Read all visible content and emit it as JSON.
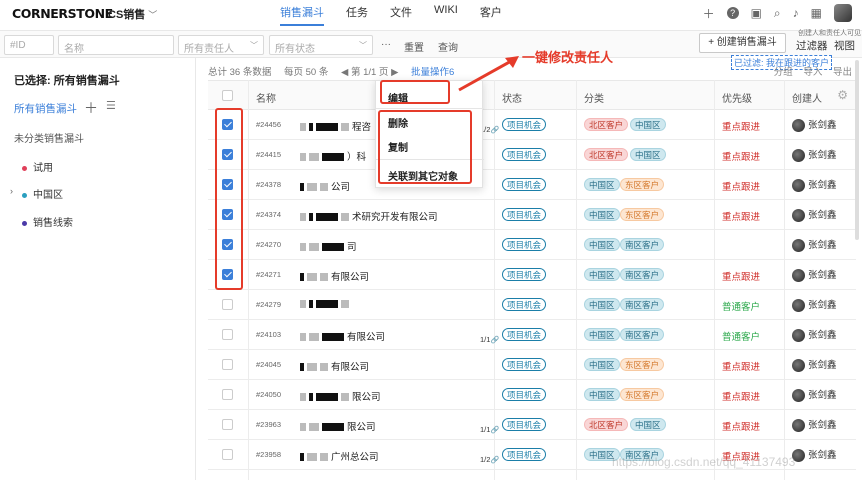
{
  "topbar": {
    "logo": "CORNERSTONE",
    "app": "CS销售",
    "nav": [
      "销售漏斗",
      "任务",
      "文件",
      "WIKI",
      "客户"
    ]
  },
  "filterbar": {
    "id_placeholder": "#ID",
    "name_placeholder": "名称",
    "owner_placeholder": "所有责任人",
    "status_placeholder": "所有状态",
    "more": "···",
    "reset": "重置",
    "query": "查询",
    "create": "+ 创建销售漏斗",
    "filter": "过滤器",
    "view": "视图",
    "note": "创建人和责任人可见"
  },
  "sidebar": {
    "selected": "已选择:  所有销售漏斗",
    "all": "所有销售漏斗",
    "uncategorized": "未分类销售漏斗",
    "items": [
      {
        "label": "试用",
        "color": "#e0405a"
      },
      {
        "label": "中国区",
        "color": "#2a9fbf"
      },
      {
        "label": "销售线索",
        "color": "#4b3aa8"
      }
    ]
  },
  "summary": {
    "total": "总计 36 条数据",
    "per_page": "每页 50 条",
    "page": "◀  第 1/1 页  ▶",
    "batch": "批量操作6",
    "group": "分组",
    "import": "导入",
    "export": "导出",
    "filter_tag": "已过滤: 我在跟进的客户"
  },
  "columns": [
    "名称",
    "状态",
    "分类",
    "优先级",
    "创建人"
  ],
  "rows": [
    {
      "id": "#24456",
      "name": "程咨",
      "checked": true,
      "status": "项目机会",
      "tags": [
        [
          "北区客户",
          "n"
        ],
        [
          "中国区",
          "c"
        ]
      ],
      "priority": "重点跟进",
      "prio_color": "red",
      "creator": "张剑鑫",
      "link": "1/2"
    },
    {
      "id": "#24415",
      "name": "）科",
      "checked": true,
      "status": "项目机会",
      "tags": [
        [
          "北区客户",
          "n"
        ],
        [
          "中国区",
          "c"
        ]
      ],
      "priority": "重点跟进",
      "prio_color": "red",
      "creator": "张剑鑫",
      "link": ""
    },
    {
      "id": "#24378",
      "name": "公司",
      "checked": true,
      "status": "项目机会",
      "tags": [
        [
          "中国区",
          "c"
        ],
        [
          "东区客户",
          "e"
        ]
      ],
      "priority": "重点跟进",
      "prio_color": "red",
      "creator": "张剑鑫",
      "link": ""
    },
    {
      "id": "#24374",
      "name": "术研究开发有限公司",
      "checked": true,
      "status": "项目机会",
      "tags": [
        [
          "中国区",
          "c"
        ],
        [
          "东区客户",
          "e"
        ]
      ],
      "priority": "重点跟进",
      "prio_color": "red",
      "creator": "张剑鑫",
      "link": ""
    },
    {
      "id": "#24270",
      "name": "司",
      "checked": true,
      "status": "项目机会",
      "tags": [
        [
          "中国区",
          "c"
        ],
        [
          "南区客户",
          "s"
        ]
      ],
      "priority": "",
      "prio_color": "red",
      "creator": "张剑鑫",
      "link": ""
    },
    {
      "id": "#24271",
      "name": "有限公司",
      "checked": true,
      "status": "项目机会",
      "tags": [
        [
          "中国区",
          "c"
        ],
        [
          "南区客户",
          "s"
        ]
      ],
      "priority": "重点跟进",
      "prio_color": "red",
      "creator": "张剑鑫",
      "link": ""
    },
    {
      "id": "#24279",
      "name": "",
      "checked": false,
      "status": "项目机会",
      "tags": [
        [
          "中国区",
          "c"
        ],
        [
          "南区客户",
          "s"
        ]
      ],
      "priority": "普通客户",
      "prio_color": "green",
      "creator": "张剑鑫",
      "link": ""
    },
    {
      "id": "#24103",
      "name": "有限公司",
      "checked": false,
      "status": "项目机会",
      "tags": [
        [
          "中国区",
          "c"
        ],
        [
          "南区客户",
          "s"
        ]
      ],
      "priority": "普通客户",
      "prio_color": "green",
      "creator": "张剑鑫",
      "link": "1/1"
    },
    {
      "id": "#24045",
      "name": "有限公司",
      "checked": false,
      "status": "项目机会",
      "tags": [
        [
          "中国区",
          "c"
        ],
        [
          "东区客户",
          "e"
        ]
      ],
      "priority": "重点跟进",
      "prio_color": "red",
      "creator": "张剑鑫",
      "link": ""
    },
    {
      "id": "#24050",
      "name": "限公司",
      "checked": false,
      "status": "项目机会",
      "tags": [
        [
          "中国区",
          "c"
        ],
        [
          "东区客户",
          "e"
        ]
      ],
      "priority": "重点跟进",
      "prio_color": "red",
      "creator": "张剑鑫",
      "link": ""
    },
    {
      "id": "#23963",
      "name": "限公司",
      "checked": false,
      "status": "项目机会",
      "tags": [
        [
          "北区客户",
          "n"
        ],
        [
          "中国区",
          "c"
        ]
      ],
      "priority": "重点跟进",
      "prio_color": "red",
      "creator": "张剑鑫",
      "link": "1/1"
    },
    {
      "id": "#23958",
      "name": "广州总公司",
      "checked": false,
      "status": "项目机会",
      "tags": [
        [
          "中国区",
          "c"
        ],
        [
          "南区客户",
          "s"
        ]
      ],
      "priority": "重点跟进",
      "prio_color": "red",
      "creator": "张剑鑫",
      "link": "1/2"
    }
  ],
  "context_menu": [
    "编辑",
    "删除",
    "复制",
    "关联到其它对象"
  ],
  "annotation": "一键修改责任人",
  "watermark": "https://blog.csdn.net/qq_41137493"
}
